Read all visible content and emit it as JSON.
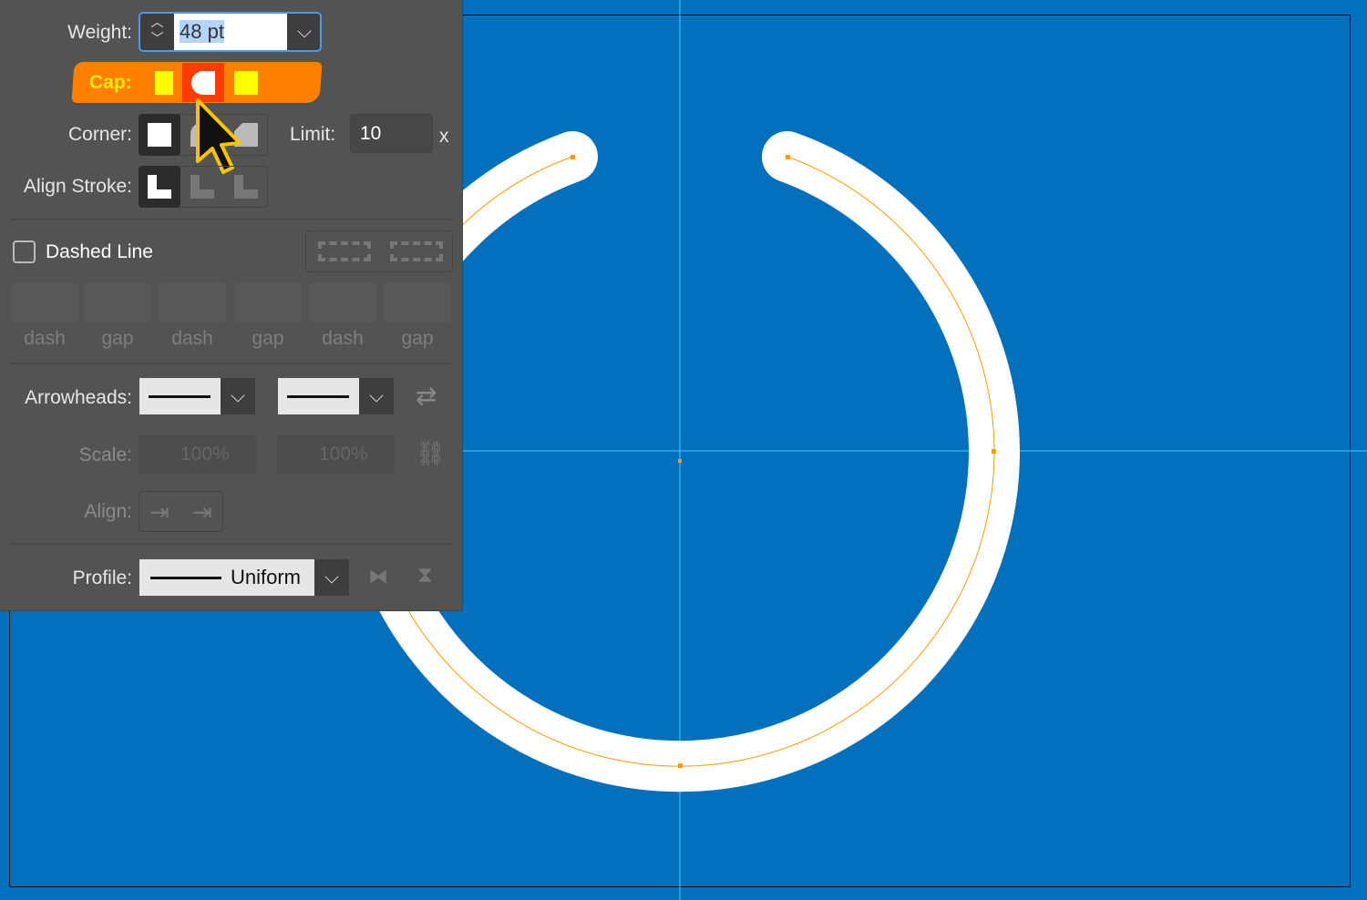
{
  "stroke_panel": {
    "weight": {
      "label": "Weight:",
      "value": "48 pt"
    },
    "cap": {
      "label": "Cap:",
      "options": [
        "butt-cap",
        "round-cap",
        "projecting-cap"
      ],
      "selected": "round-cap",
      "highlight_color": "#ff8000"
    },
    "corner": {
      "label": "Corner:",
      "options": [
        "miter-join",
        "round-join",
        "bevel-join"
      ],
      "selected": "miter-join",
      "limit_label": "Limit:",
      "limit_value": "10",
      "limit_unit": "x"
    },
    "align_stroke": {
      "label": "Align Stroke:",
      "options": [
        "center",
        "inside",
        "outside"
      ],
      "selected": "center"
    },
    "dashed_line": {
      "label": "Dashed Line",
      "checked": false,
      "fields": [
        "dash",
        "gap",
        "dash",
        "gap",
        "dash",
        "gap"
      ]
    },
    "arrowheads": {
      "label": "Arrowheads:"
    },
    "scale": {
      "label": "Scale:",
      "start": "100%",
      "end": "100%"
    },
    "align": {
      "label": "Align:"
    },
    "profile": {
      "label": "Profile:",
      "value": "Uniform"
    }
  },
  "artwork": {
    "background": "#0370be",
    "stroke_color": "#ffffff",
    "path_color": "#ff9a00",
    "guide_color": "#35d0ff"
  }
}
